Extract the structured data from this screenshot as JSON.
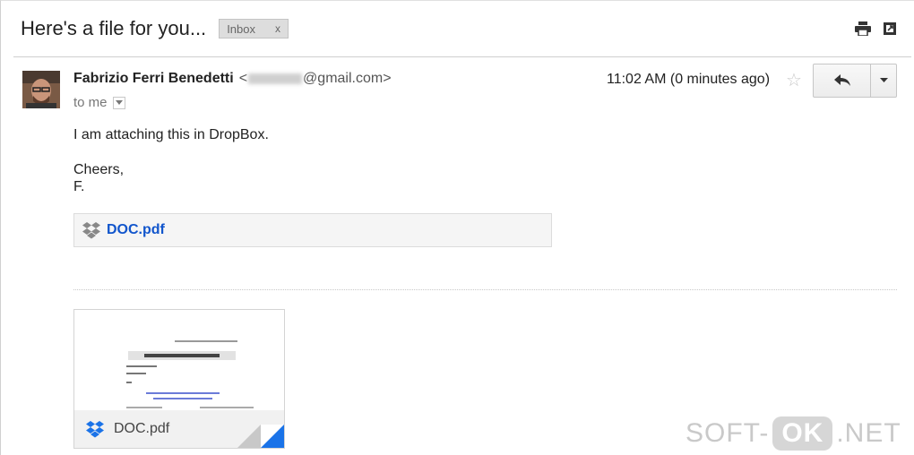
{
  "email": {
    "subject": "Here's a file for you...",
    "label": "Inbox",
    "label_remove": "x",
    "sender_name": "Fabrizio Ferri Benedetti",
    "sender_email_open": "<",
    "sender_email_suffix": "@gmail.com>",
    "to_text": "to me",
    "timestamp": "11:02 AM (0 minutes ago)",
    "body_line1": "I am attaching this in DropBox.",
    "body_line2": "Cheers,",
    "body_line3": "F.",
    "attachment_link": "DOC.pdf",
    "thumbnail_name": "DOC.pdf"
  },
  "icons": {
    "print": "print-icon",
    "new_window": "new-window-icon",
    "star": "star-icon",
    "reply": "reply-icon",
    "more": "chevron-down-icon",
    "dropbox": "dropbox-icon"
  },
  "watermark": {
    "left": "SOFT-",
    "middle": "OK",
    "right": ".NET"
  },
  "colors": {
    "link": "#1155cc",
    "dropbox": "#1a73e8",
    "chip_bg": "#dddddd"
  }
}
